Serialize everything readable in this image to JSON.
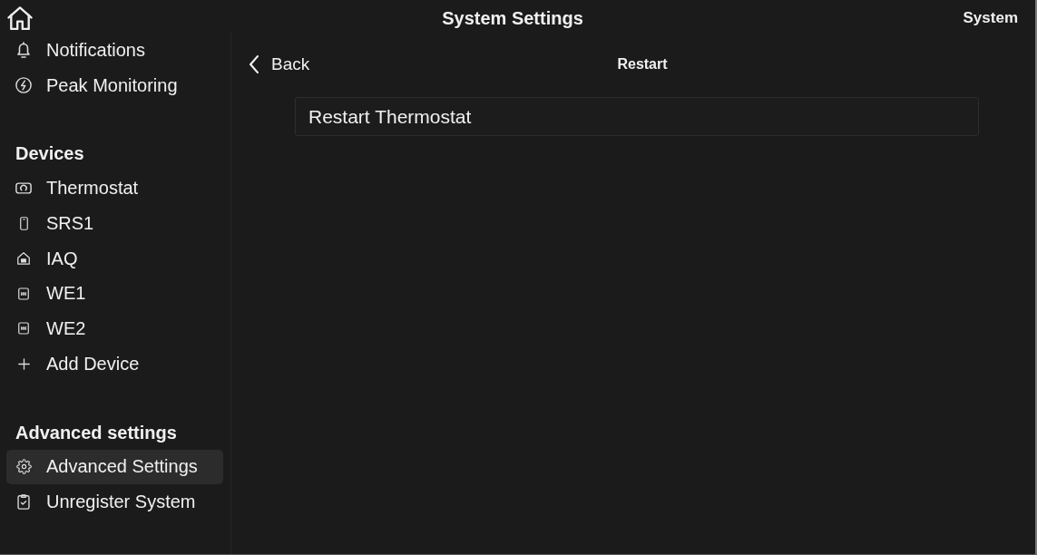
{
  "header": {
    "title": "System Settings",
    "system_label": "System"
  },
  "sidebar": {
    "sections": [
      {
        "items": [
          {
            "label": "Notifications",
            "selected": false
          },
          {
            "label": "Peak Monitoring",
            "selected": false
          }
        ]
      },
      {
        "heading": "Devices",
        "items": [
          {
            "label": "Thermostat",
            "selected": false
          },
          {
            "label": "SRS1",
            "selected": false
          },
          {
            "label": "IAQ",
            "selected": false
          },
          {
            "label": "WE1",
            "selected": false
          },
          {
            "label": "WE2",
            "selected": false
          },
          {
            "label": "Add Device",
            "selected": false
          }
        ]
      },
      {
        "heading": "Advanced settings",
        "items": [
          {
            "label": "Advanced Settings",
            "selected": true
          },
          {
            "label": "Unregister System",
            "selected": false
          }
        ]
      }
    ]
  },
  "panel": {
    "back": "Back",
    "title": "Restart",
    "options": [
      {
        "label": "Restart Thermostat"
      }
    ]
  }
}
